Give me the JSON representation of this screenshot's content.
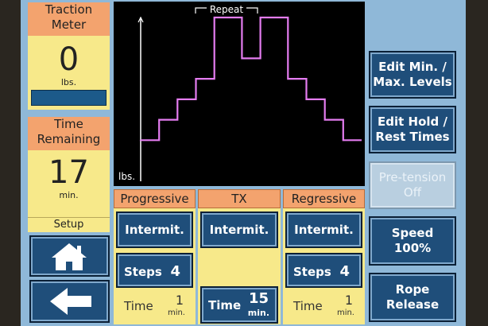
{
  "traction_meter": {
    "title_line1": "Traction",
    "title_line2": "Meter",
    "value": "0",
    "unit": "lbs."
  },
  "time_remaining": {
    "title_line1": "Time",
    "title_line2": "Remaining",
    "value": "17",
    "unit": "min."
  },
  "setup_label": "Setup",
  "chart": {
    "repeat_label": "Repeat",
    "y_unit": "lbs."
  },
  "chart_data": {
    "type": "line",
    "series": [
      {
        "values": [
          1,
          1,
          2,
          2,
          3,
          3,
          4,
          4,
          7,
          7,
          7,
          5,
          5,
          7,
          7,
          7,
          4,
          4,
          3,
          3,
          2,
          2,
          1,
          1
        ]
      }
    ],
    "annotations": [
      "Repeat"
    ],
    "ylabel": "lbs.",
    "grid": false
  },
  "columns": {
    "progressive": {
      "header": "Progressive",
      "button": "Intermit.",
      "steps_label": "Steps",
      "steps_value": "4",
      "time_label": "Time",
      "time_value": "1",
      "time_unit": "min."
    },
    "tx": {
      "header": "TX",
      "button": "Intermit.",
      "time_label": "Time",
      "time_value": "15",
      "time_unit": "min."
    },
    "regressive": {
      "header": "Regressive",
      "button": "Intermit.",
      "steps_label": "Steps",
      "steps_value": "4",
      "time_label": "Time",
      "time_value": "1",
      "time_unit": "min."
    }
  },
  "right_buttons": {
    "edit_levels": {
      "line1": "Edit Min. /",
      "line2": "Max. Levels"
    },
    "edit_hold": {
      "line1": "Edit Hold /",
      "line2": "Rest Times"
    },
    "pretension": {
      "line1": "Pre-tension",
      "line2": "Off"
    },
    "speed": {
      "line1": "Speed",
      "line2": "100%"
    },
    "rope": {
      "line1": "Rope",
      "line2": "Release"
    }
  }
}
